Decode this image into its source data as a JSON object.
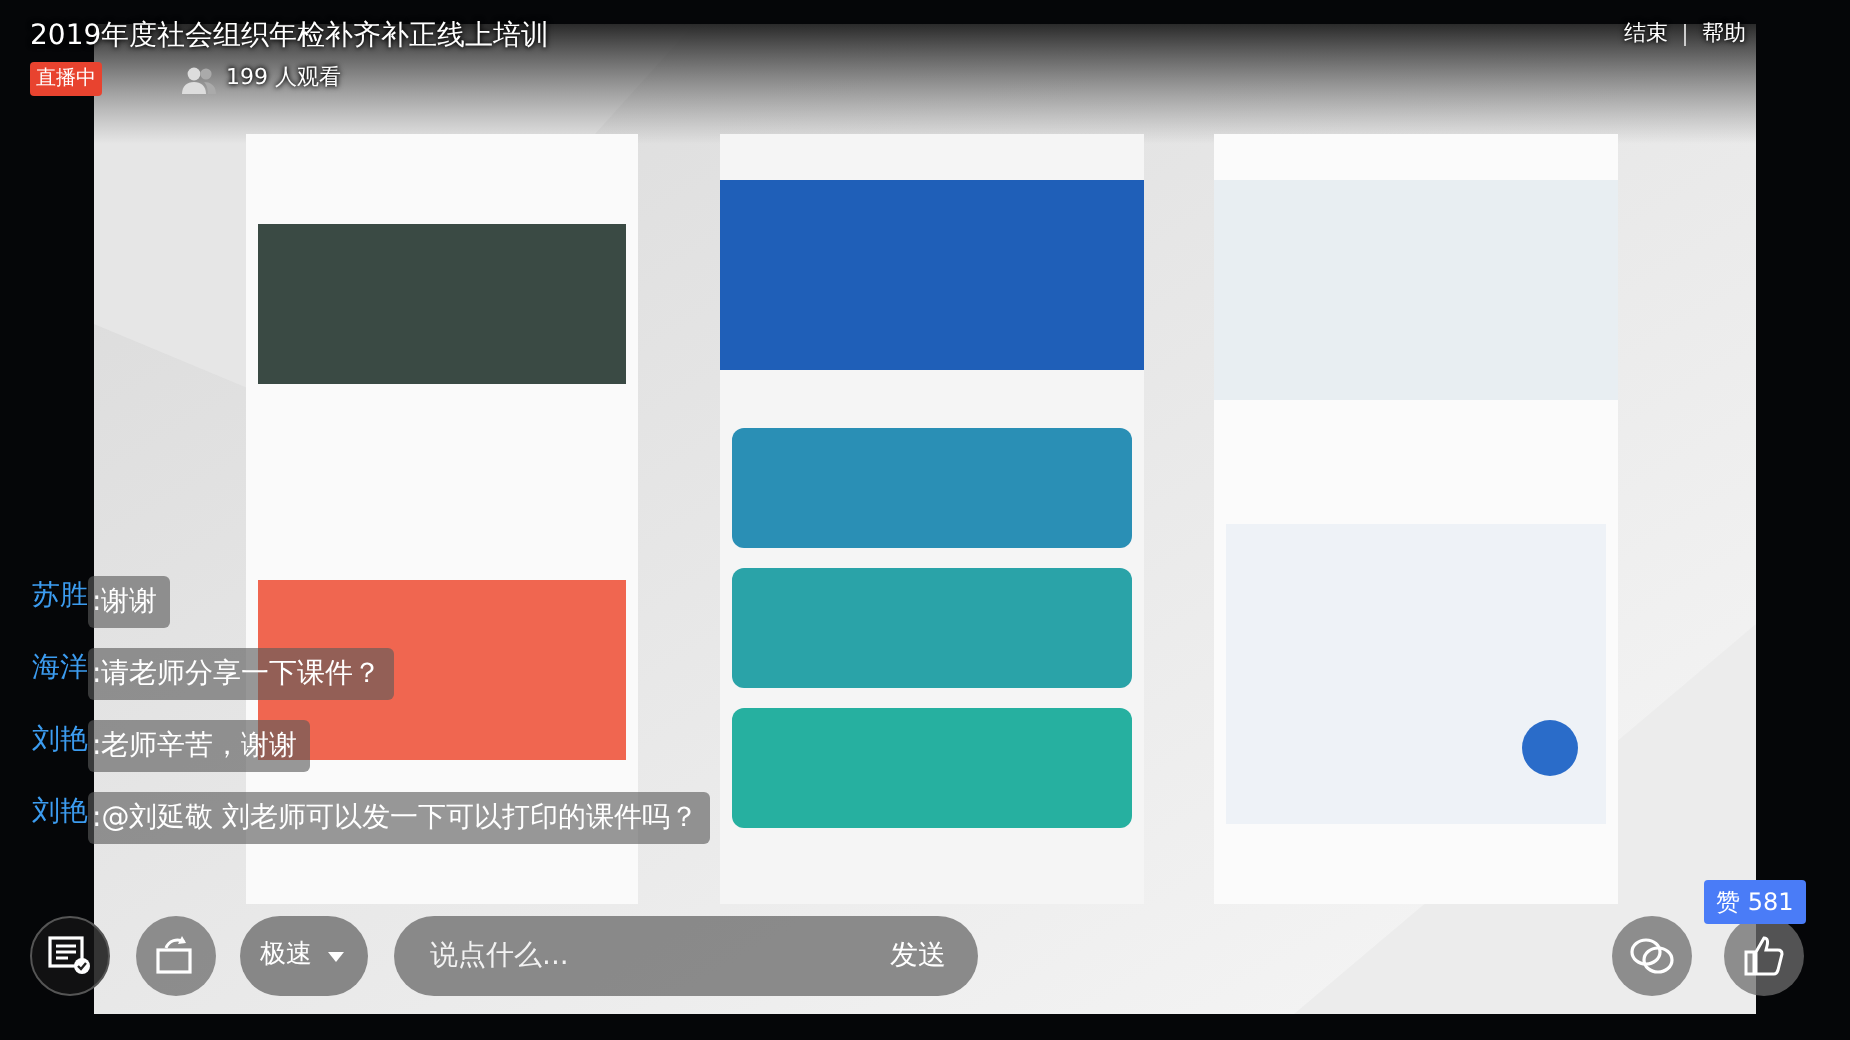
{
  "header": {
    "title": "2019年度社会组织年检补齐补正线上培训",
    "live_badge": "直播中",
    "viewers": "199 人观看",
    "links": [
      "结束",
      "帮助"
    ]
  },
  "chat": [
    {
      "name": "苏胜",
      "message": ":谢谢"
    },
    {
      "name": "海洋",
      "message": ":请老师分享一下课件？"
    },
    {
      "name": "刘艳",
      "message": ":老师辛苦，谢谢"
    },
    {
      "name": "刘艳",
      "message": ":@刘延敬 刘老师可以发一下可以打印的课件吗？"
    }
  ],
  "controls": {
    "quality": "极速",
    "comment": {
      "placeholder": "说点什么..."
    },
    "send": "发送",
    "likes": "赞 581"
  }
}
